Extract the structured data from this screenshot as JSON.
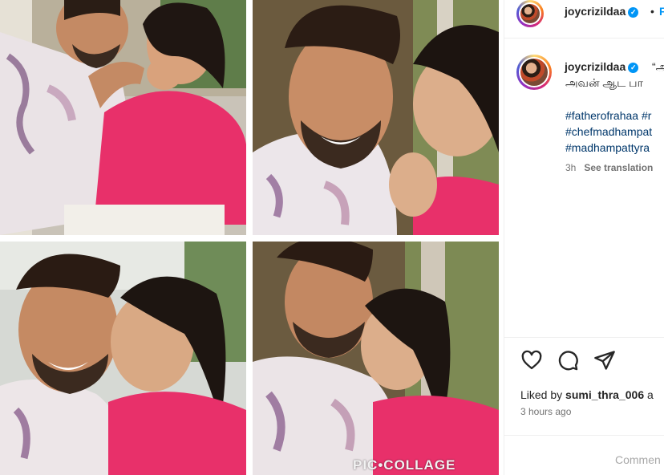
{
  "header": {
    "username": "joycrizildaa",
    "separator": "•",
    "follow_label": "F"
  },
  "caption": {
    "username": "joycrizildaa",
    "text_start": "“அ",
    "text_line2": "அவன் ஆட பா",
    "hashtags": [
      "#fatherofrahaa #r",
      "#chefmadhampat",
      "#madhampattyra"
    ],
    "time": "3h",
    "translate_label": "See translation"
  },
  "likes": {
    "prefix": "Liked by ",
    "user": "sumi_thra_006",
    "suffix": " a"
  },
  "post_time": "3 hours ago",
  "comment_placeholder": "Commen",
  "watermark": "PIC•COLLAGE",
  "colors": {
    "accent": "#0095f6",
    "hashtag": "#00376b",
    "muted": "#737373",
    "pink_shirt": "#e8306a"
  },
  "icons": [
    "heart-icon",
    "comment-icon",
    "share-icon",
    "verified-icon"
  ]
}
